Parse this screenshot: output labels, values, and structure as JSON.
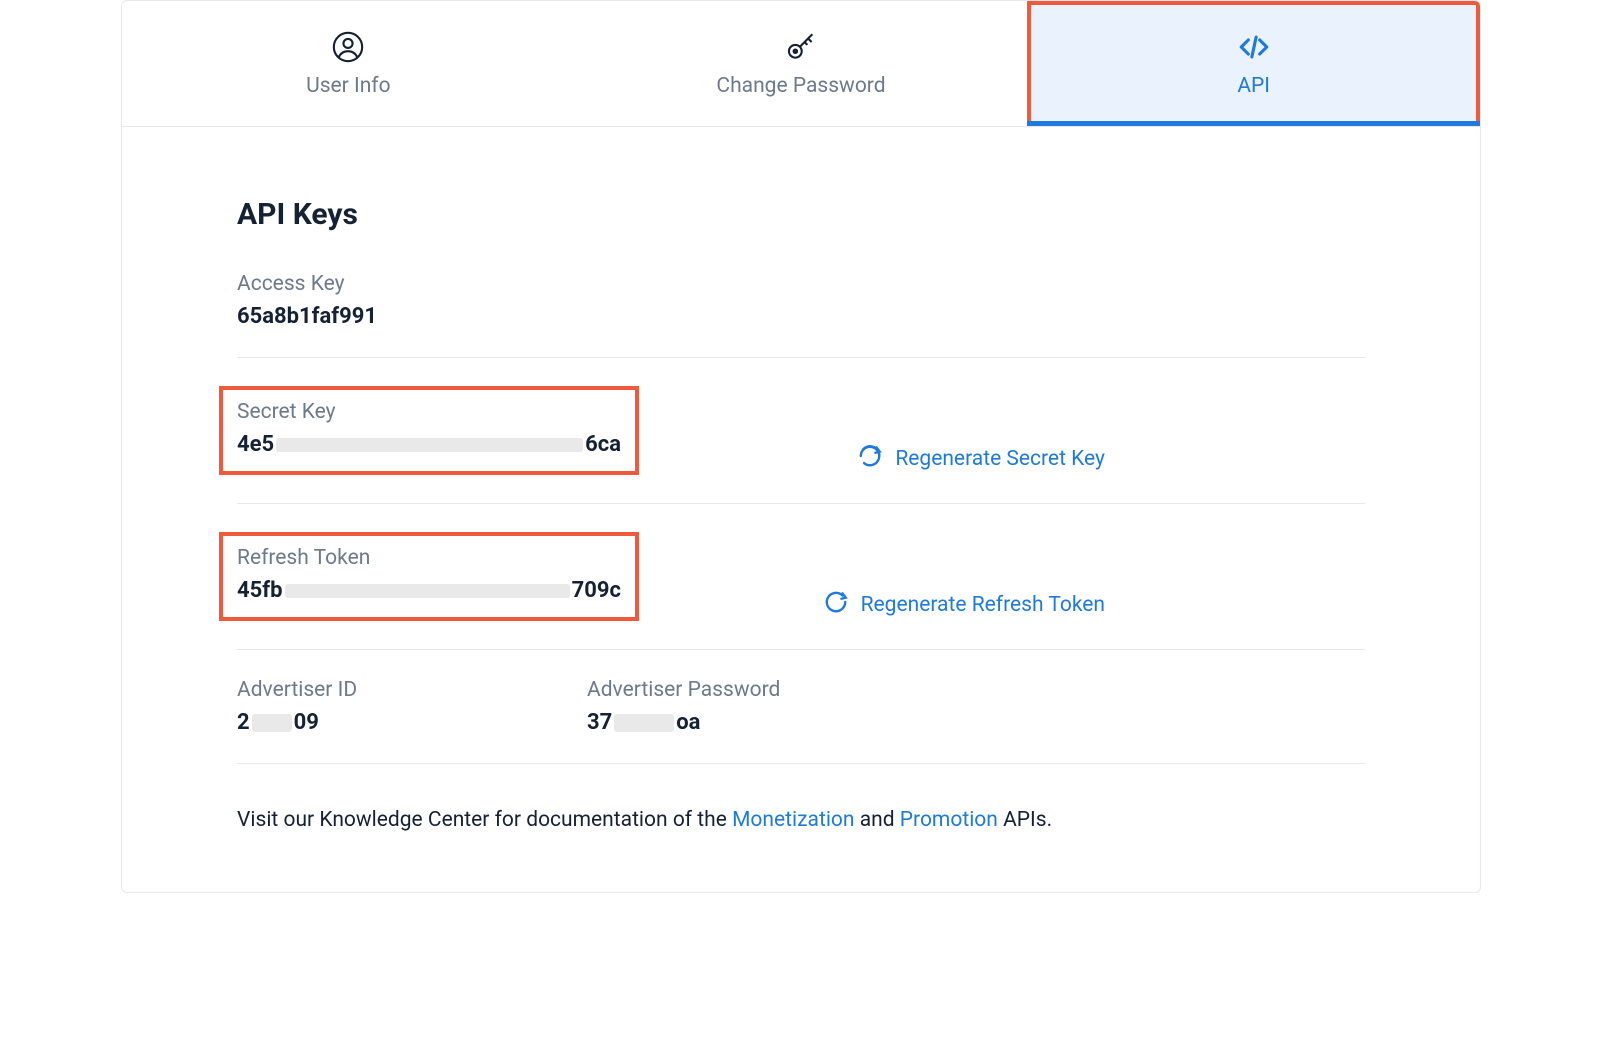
{
  "tabs": {
    "user_info": "User Info",
    "change_password": "Change Password",
    "api": "API"
  },
  "page": {
    "title": "API Keys"
  },
  "access_key": {
    "label": "Access Key",
    "value": "65a8b1faf991"
  },
  "secret_key": {
    "label": "Secret Key",
    "prefix": "4e5",
    "suffix": "6ca",
    "regen_label": "Regenerate Secret Key"
  },
  "refresh_token": {
    "label": "Refresh Token",
    "prefix": "45fb",
    "suffix": "709c",
    "regen_label": "Regenerate Refresh Token"
  },
  "advertiser_id": {
    "label": "Advertiser ID",
    "prefix": "2",
    "suffix": "09"
  },
  "advertiser_password": {
    "label": "Advertiser Password",
    "prefix": "37",
    "suffix": "oa"
  },
  "footer": {
    "pre": "Visit our Knowledge Center for documentation of the ",
    "link1": "Monetization",
    "mid": " and ",
    "link2": "Promotion",
    "post": " APIs."
  }
}
